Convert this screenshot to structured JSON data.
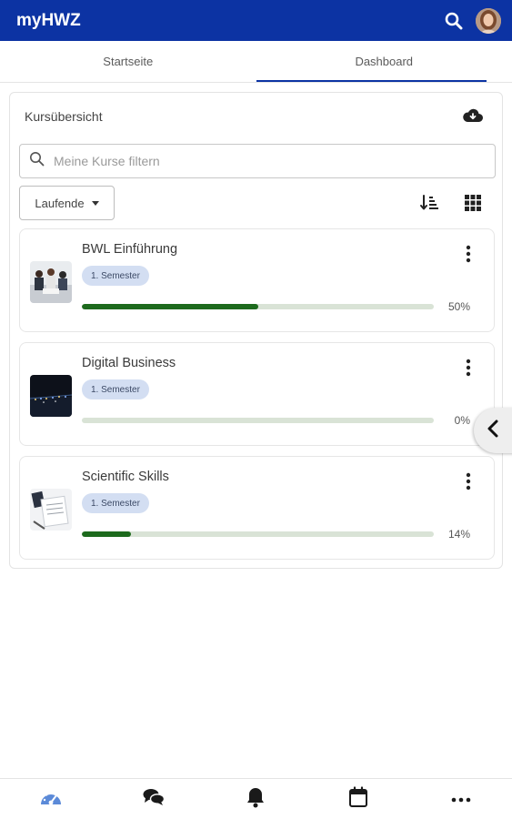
{
  "app": {
    "title": "myHWZ"
  },
  "tabs": [
    {
      "label": "Startseite",
      "active": false
    },
    {
      "label": "Dashboard",
      "active": true
    }
  ],
  "overview": {
    "title": "Kursübersicht",
    "search": {
      "placeholder": "Meine Kurse filtern",
      "value": ""
    },
    "filter": {
      "selected": "Laufende"
    },
    "courses": [
      {
        "name": "BWL Einführung",
        "badge": "1. Semester",
        "progress_label": "50%",
        "progress": 0.5
      },
      {
        "name": "Digital Business",
        "badge": "1. Semester",
        "progress_label": "0%",
        "progress": 0.0
      },
      {
        "name": "Scientific Skills",
        "badge": "1. Semester",
        "progress_label": "14%",
        "progress": 0.14
      }
    ]
  },
  "colors": {
    "brand": "#0c33a3",
    "progress": "#1d6a1d",
    "progress_track": "#d9e3d6",
    "badge": "#d3def2",
    "active_nav": "#5b8ad8"
  },
  "icons": {
    "app_bar": [
      "search-icon",
      "avatar"
    ],
    "overview": [
      "cloud-download-icon",
      "sort-icon",
      "grid-view-icon",
      "kebab-menu-icon",
      "chevron-left-icon"
    ],
    "bottom_nav": [
      "dashboard-icon",
      "chat-icon",
      "bell-icon",
      "calendar-icon",
      "more-icon"
    ]
  }
}
